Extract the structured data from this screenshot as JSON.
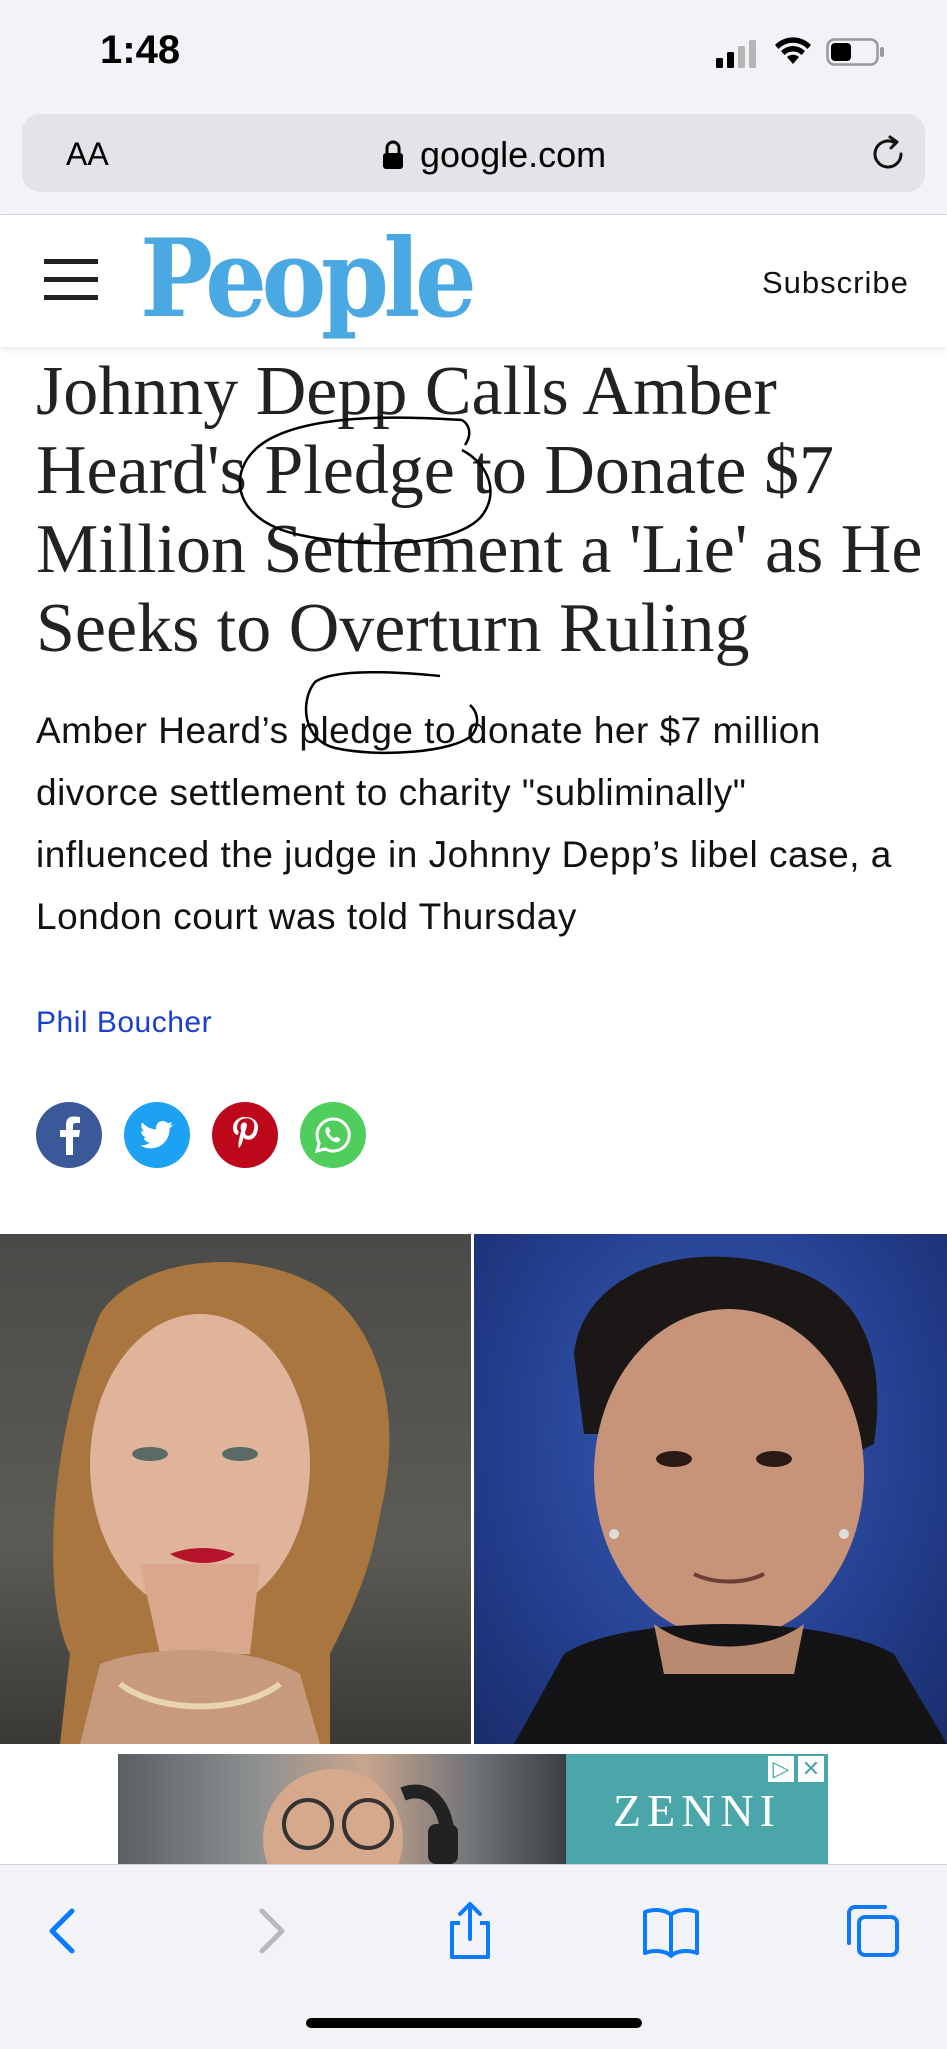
{
  "status_bar": {
    "time": "1:48"
  },
  "browser": {
    "text_size_label": "AA",
    "url": "google.com"
  },
  "site": {
    "logo": "People",
    "subscribe_label": "Subscribe"
  },
  "article": {
    "headline": "Johnny Depp Calls Amber Heard's Pledge to Donate $7 Million Settlement a 'Lie' as He Seeks to Overturn Ruling",
    "dek": "Amber Heard’s pledge to donate her $7 million divorce settlement to charity \"subliminally\" influenced the judge in Johnny Depp’s libel case, a London court was told Thursday",
    "author": "Phil Boucher"
  },
  "social_share": {
    "items": [
      {
        "network": "facebook",
        "icon": "facebook-icon",
        "color": "#3b5998",
        "glyph": "f"
      },
      {
        "network": "twitter",
        "icon": "twitter-icon",
        "color": "#1da1f2"
      },
      {
        "network": "pinterest",
        "icon": "pinterest-icon",
        "color": "#bd081c",
        "glyph": "P"
      },
      {
        "network": "whatsapp",
        "icon": "whatsapp-icon",
        "color": "#4fce5d"
      }
    ]
  },
  "ad": {
    "brand": "ZENNI"
  },
  "colors": {
    "brand": "#4aa8e2",
    "link": "#1a3fcf",
    "ios_blue": "#0a7aff",
    "annotation_ink": "#000000"
  }
}
